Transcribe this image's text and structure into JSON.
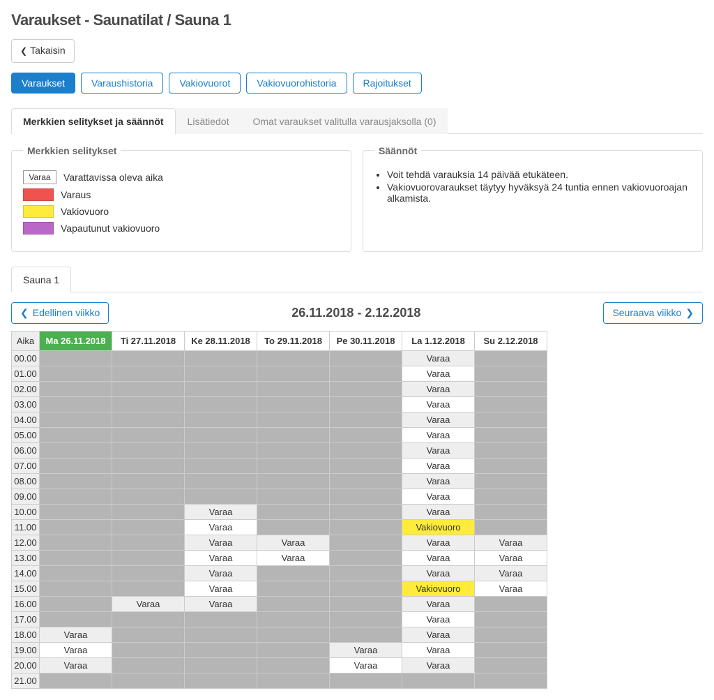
{
  "page_title": "Varaukset - Saunatilat / Sauna 1",
  "back_button": "Takaisin",
  "main_tabs": [
    {
      "id": "varaukset",
      "label": "Varaukset",
      "active": true
    },
    {
      "id": "varaushistoria",
      "label": "Varaushistoria",
      "active": false
    },
    {
      "id": "vakiovuorot",
      "label": "Vakiovuorot",
      "active": false
    },
    {
      "id": "vakiovuorohistoria",
      "label": "Vakiovuorohistoria",
      "active": false
    },
    {
      "id": "rajoitukset",
      "label": "Rajoitukset",
      "active": false
    }
  ],
  "sub_tabs": [
    {
      "id": "merkkien",
      "label": "Merkkien selitykset ja säännöt",
      "active": true
    },
    {
      "id": "lisatiedot",
      "label": "Lisätiedot",
      "active": false
    },
    {
      "id": "omat",
      "label": "Omat varaukset valitulla varausjaksolla (0)",
      "active": false
    }
  ],
  "legend_title": "Merkkien selitykset",
  "legend": {
    "varaa_label": "Varaa",
    "varaa_desc": "Varattavissa oleva aika",
    "varaus": "Varaus",
    "vakiovuoro": "Vakiovuoro",
    "vapautunut": "Vapautunut vakiovuoro"
  },
  "rules_title": "Säännöt",
  "rules": [
    "Voit tehdä varauksia 14 päivää etukäteen.",
    "Vakiovuorovaraukset täytyy hyväksyä 24 tuntia ennen vakiovuoroajan alkamista."
  ],
  "resource_tab": "Sauna 1",
  "prev_week": "Edellinen viikko",
  "next_week": "Seuraava viikko",
  "date_range": "26.11.2018 - 2.12.2018",
  "time_header": "Aika",
  "days": [
    {
      "label": "Ma 26.11.2018",
      "today": true
    },
    {
      "label": "Ti 27.11.2018",
      "today": false
    },
    {
      "label": "Ke 28.11.2018",
      "today": false
    },
    {
      "label": "To 29.11.2018",
      "today": false
    },
    {
      "label": "Pe 30.11.2018",
      "today": false
    },
    {
      "label": "La 1.12.2018",
      "today": false
    },
    {
      "label": "Su 2.12.2018",
      "today": false
    }
  ],
  "hours": [
    "00.00",
    "01.00",
    "02.00",
    "03.00",
    "04.00",
    "05.00",
    "06.00",
    "07.00",
    "08.00",
    "09.00",
    "10.00",
    "11.00",
    "12.00",
    "13.00",
    "14.00",
    "15.00",
    "16.00",
    "17.00",
    "18.00",
    "19.00",
    "20.00",
    "21.00"
  ],
  "cell_labels": {
    "varaa": "Varaa",
    "vakiovuoro": "Vakiovuoro"
  },
  "grid": [
    [
      "gray",
      "gray",
      "gray",
      "gray",
      "gray",
      "varaa_g",
      "gray"
    ],
    [
      "gray",
      "gray",
      "gray",
      "gray",
      "gray",
      "varaa_w",
      "gray"
    ],
    [
      "gray",
      "gray",
      "gray",
      "gray",
      "gray",
      "varaa_g",
      "gray"
    ],
    [
      "gray",
      "gray",
      "gray",
      "gray",
      "gray",
      "varaa_w",
      "gray"
    ],
    [
      "gray",
      "gray",
      "gray",
      "gray",
      "gray",
      "varaa_g",
      "gray"
    ],
    [
      "gray",
      "gray",
      "gray",
      "gray",
      "gray",
      "varaa_w",
      "gray"
    ],
    [
      "gray",
      "gray",
      "gray",
      "gray",
      "gray",
      "varaa_g",
      "gray"
    ],
    [
      "gray",
      "gray",
      "gray",
      "gray",
      "gray",
      "varaa_w",
      "gray"
    ],
    [
      "gray",
      "gray",
      "gray",
      "gray",
      "gray",
      "varaa_g",
      "gray"
    ],
    [
      "gray",
      "gray",
      "gray",
      "gray",
      "gray",
      "varaa_w",
      "gray"
    ],
    [
      "gray",
      "gray",
      "varaa_g",
      "gray",
      "gray",
      "varaa_g",
      "gray"
    ],
    [
      "gray",
      "gray",
      "varaa_w",
      "gray",
      "gray",
      "vakio",
      "gray"
    ],
    [
      "gray",
      "gray",
      "varaa_g",
      "varaa_g",
      "gray",
      "varaa_g",
      "varaa_g"
    ],
    [
      "gray",
      "gray",
      "varaa_w",
      "varaa_w",
      "gray",
      "varaa_w",
      "varaa_w"
    ],
    [
      "gray",
      "gray",
      "varaa_g",
      "gray",
      "gray",
      "varaa_g",
      "varaa_g"
    ],
    [
      "gray",
      "gray",
      "varaa_w",
      "gray",
      "gray",
      "vakio",
      "varaa_w"
    ],
    [
      "gray",
      "varaa_g",
      "varaa_g",
      "gray",
      "gray",
      "varaa_g",
      "gray"
    ],
    [
      "gray",
      "gray",
      "gray",
      "gray",
      "gray",
      "varaa_w",
      "gray"
    ],
    [
      "varaa_g",
      "gray",
      "gray",
      "gray",
      "gray",
      "varaa_g",
      "gray"
    ],
    [
      "varaa_w",
      "gray",
      "gray",
      "gray",
      "varaa_g",
      "varaa_w",
      "gray"
    ],
    [
      "varaa_g",
      "gray",
      "gray",
      "gray",
      "varaa_w",
      "varaa_g",
      "gray"
    ],
    [
      "gray",
      "gray",
      "gray",
      "gray",
      "gray",
      "gray",
      "gray"
    ]
  ]
}
